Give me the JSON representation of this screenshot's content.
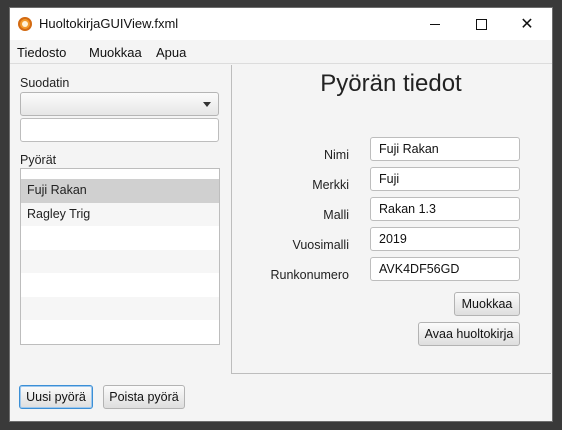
{
  "window": {
    "title": "HuoltokirjaGUIView.fxml"
  },
  "menu": [
    "Tiedosto",
    "Muokkaa",
    "Apua"
  ],
  "left": {
    "filter_label": "Suodatin",
    "combo_value": "",
    "filter_text": "",
    "list_label": "Pyörät",
    "bikes": [
      "Fuji Rakan",
      "Ragley Trig"
    ],
    "selected_index": 0,
    "new_button": "Uusi pyörä",
    "delete_button": "Poista pyörä"
  },
  "details": {
    "heading": "Pyörän tiedot",
    "fields": [
      {
        "label": "Nimi",
        "value": "Fuji Rakan"
      },
      {
        "label": "Merkki",
        "value": "Fuji"
      },
      {
        "label": "Malli",
        "value": "Rakan 1.3"
      },
      {
        "label": "Vuosimalli",
        "value": "2019"
      },
      {
        "label": "Runkonumero",
        "value": "AVK4DF56GD"
      }
    ],
    "edit_button": "Muokkaa",
    "open_log_button": "Avaa huoltokirja"
  }
}
